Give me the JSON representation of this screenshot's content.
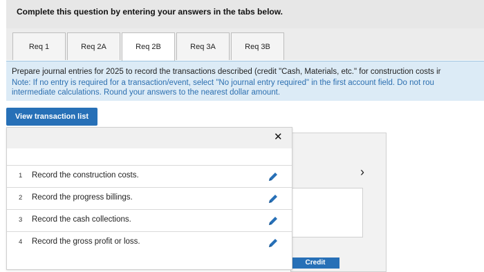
{
  "header": {
    "title": "Complete this question by entering your answers in the tabs below."
  },
  "tabs": [
    {
      "label": "Req 1",
      "active": false
    },
    {
      "label": "Req 2A",
      "active": false
    },
    {
      "label": "Req 2B",
      "active": true
    },
    {
      "label": "Req 3A",
      "active": false
    },
    {
      "label": "Req 3B",
      "active": false
    }
  ],
  "instructions": {
    "main": "Prepare journal entries for 2025 to record the transactions described (credit \"Cash, Materials, etc.\" for construction costs ir",
    "note_line1": "Note: If no entry is required for a transaction/event, select \"No journal entry required\" in the first account field. Do not rou",
    "note_line2": "intermediate calculations. Round your answers to the nearest dollar amount."
  },
  "view_button": {
    "label": "View transaction list"
  },
  "transactions": [
    {
      "num": "1",
      "text": "Record the construction costs."
    },
    {
      "num": "2",
      "text": "Record the progress billings."
    },
    {
      "num": "3",
      "text": "Record the cash collections."
    },
    {
      "num": "4",
      "text": "Record the gross profit or loss."
    }
  ],
  "popup": {
    "close_icon": "close-icon",
    "close_glyph": "✕"
  },
  "navigation": {
    "next_glyph": "›"
  },
  "journal": {
    "credit_label": "Credit"
  },
  "colors": {
    "accent": "#2770b7",
    "note": "#2c6fb0",
    "instructions_bg": "#dcebf6"
  }
}
